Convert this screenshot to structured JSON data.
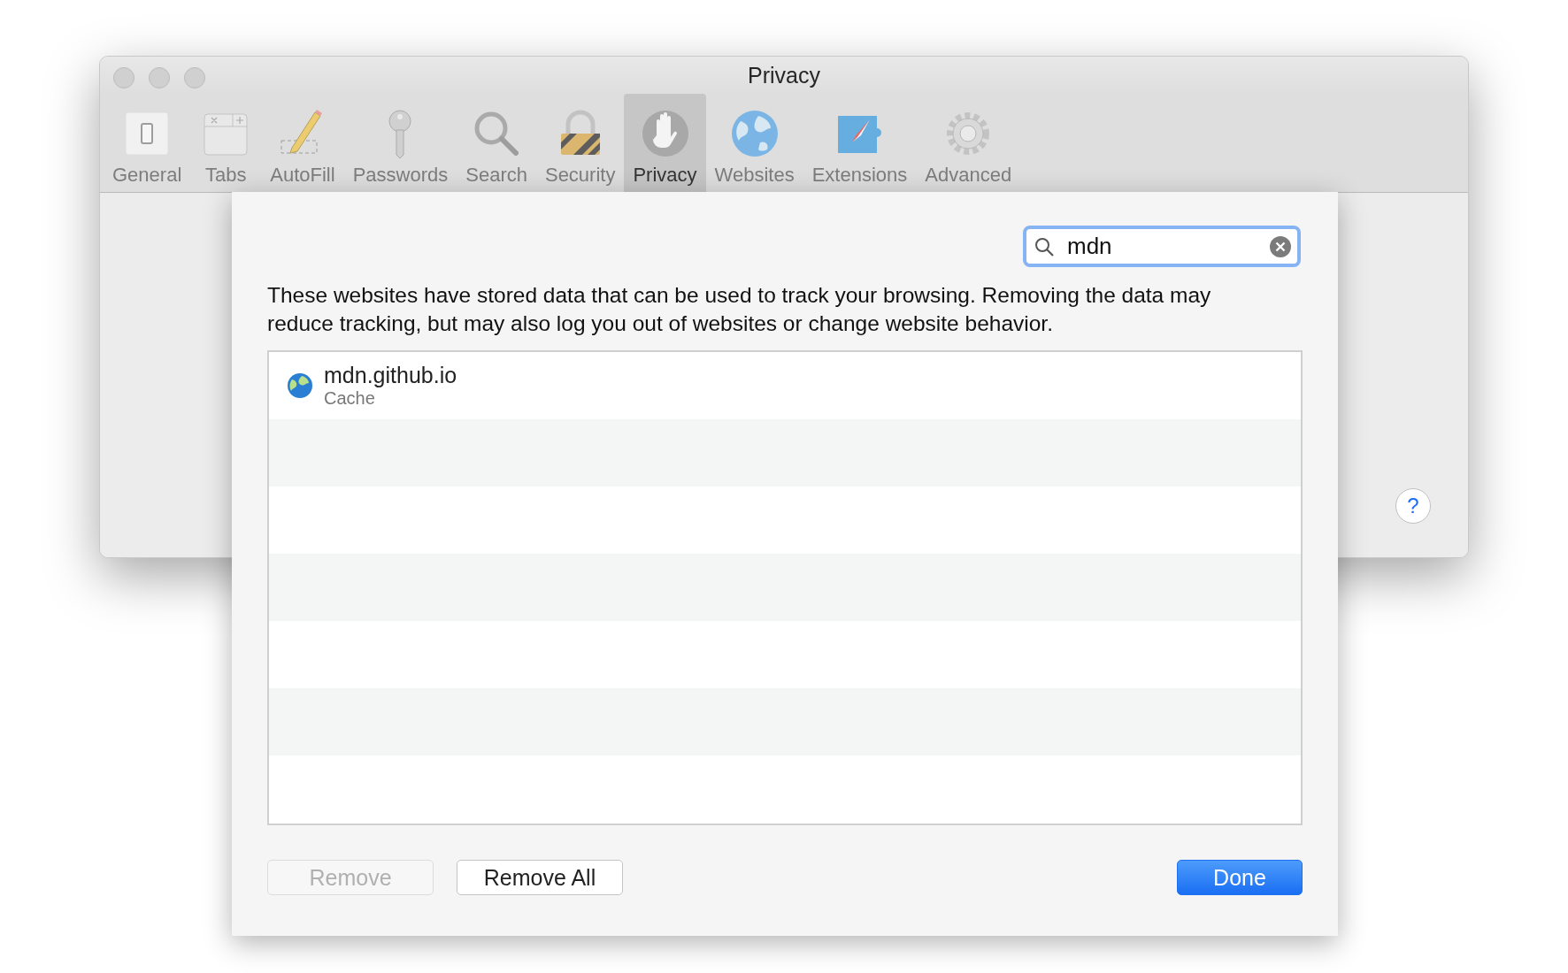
{
  "window": {
    "title": "Privacy"
  },
  "toolbar": [
    {
      "label": "General",
      "kind": "switch",
      "selected": false
    },
    {
      "label": "Tabs",
      "kind": "tabs",
      "selected": false
    },
    {
      "label": "AutoFill",
      "kind": "pencil",
      "selected": false
    },
    {
      "label": "Passwords",
      "kind": "key",
      "selected": false
    },
    {
      "label": "Search",
      "kind": "magnifier",
      "selected": false
    },
    {
      "label": "Security",
      "kind": "padlock",
      "selected": false
    },
    {
      "label": "Privacy",
      "kind": "hand",
      "selected": true
    },
    {
      "label": "Websites",
      "kind": "globe",
      "selected": false
    },
    {
      "label": "Extensions",
      "kind": "compass",
      "selected": false
    },
    {
      "label": "Advanced",
      "kind": "gear",
      "selected": false
    }
  ],
  "sheet": {
    "search": {
      "value": "mdn"
    },
    "description": "These websites have stored data that can be used to track your browsing. Removing the data may reduce tracking, but may also log you out of websites or change website behavior.",
    "websites": [
      {
        "name": "mdn.github.io",
        "detail": "Cache"
      }
    ],
    "buttons": [
      {
        "label": "Remove",
        "disabled": true,
        "primary": false
      },
      {
        "label": "Remove All",
        "disabled": false,
        "primary": false
      },
      {
        "label": "Done",
        "disabled": false,
        "primary": true
      }
    ]
  },
  "help": {
    "label": "?"
  }
}
